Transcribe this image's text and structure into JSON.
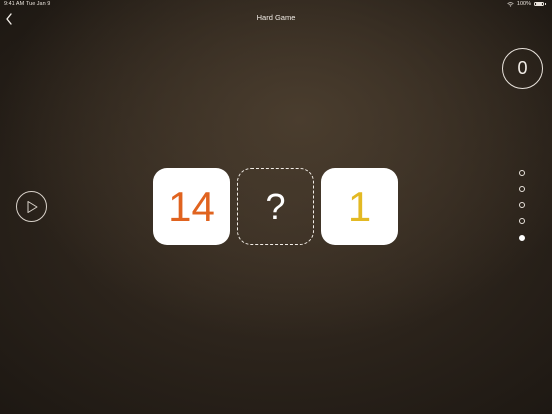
{
  "status_bar": {
    "time": "9:41 AM",
    "date": "Tue Jan 9",
    "battery": "100%"
  },
  "header": {
    "title": "Hard Game",
    "back_icon": "chevron-left-icon"
  },
  "score": {
    "value": "0"
  },
  "play_button": {
    "icon": "play-icon"
  },
  "puzzle": {
    "left_number": "14",
    "left_color": "#e0631f",
    "unknown": "?",
    "right_number": "1",
    "right_color": "#e3b923"
  },
  "page_indicator": {
    "total": 5,
    "active_index": 4
  }
}
